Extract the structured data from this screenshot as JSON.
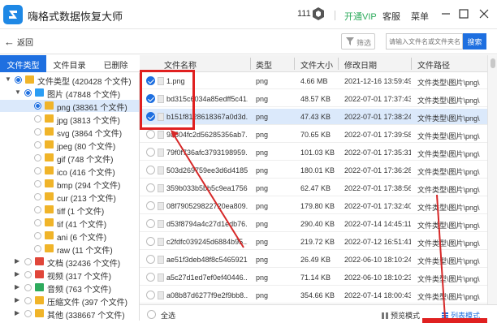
{
  "titlebar": {
    "app_title": "嗨格式数据恢复大师",
    "count": "111",
    "vip": "开通VIP",
    "service": "客服",
    "menu": "菜单"
  },
  "toolbar": {
    "back": "返回",
    "filter": "筛选",
    "search_placeholder": "请输入文件名或文件夹名",
    "search_btn": "搜索"
  },
  "tabs": [
    "文件类型",
    "文件目录",
    "已删除"
  ],
  "tree": [
    {
      "label": "文件类型 (420428 个文件)",
      "indent": 0,
      "exp": "▼",
      "radio": "part",
      "color": "#f0b429"
    },
    {
      "label": "图片 (47848 个文件)",
      "indent": 1,
      "exp": "▼",
      "radio": "part",
      "color": "#2a9df4"
    },
    {
      "label": "png (38361 个文件)",
      "indent": 2,
      "exp": "",
      "radio": "part",
      "color": "#f0b429",
      "selected": true
    },
    {
      "label": "jpg (3813 个文件)",
      "indent": 2,
      "exp": "",
      "radio": "none",
      "color": "#f0b429"
    },
    {
      "label": "svg (3864 个文件)",
      "indent": 2,
      "exp": "",
      "radio": "none",
      "color": "#f0b429"
    },
    {
      "label": "jpeg (80 个文件)",
      "indent": 2,
      "exp": "",
      "radio": "none",
      "color": "#f0b429"
    },
    {
      "label": "gif (748 个文件)",
      "indent": 2,
      "exp": "",
      "radio": "none",
      "color": "#f0b429"
    },
    {
      "label": "ico (416 个文件)",
      "indent": 2,
      "exp": "",
      "radio": "none",
      "color": "#f0b429"
    },
    {
      "label": "bmp (294 个文件)",
      "indent": 2,
      "exp": "",
      "radio": "none",
      "color": "#f0b429"
    },
    {
      "label": "cur (213 个文件)",
      "indent": 2,
      "exp": "",
      "radio": "none",
      "color": "#f0b429"
    },
    {
      "label": "tiff (1 个文件)",
      "indent": 2,
      "exp": "",
      "radio": "none",
      "color": "#f0b429"
    },
    {
      "label": "tif (41 个文件)",
      "indent": 2,
      "exp": "",
      "radio": "none",
      "color": "#f0b429"
    },
    {
      "label": "ani (6 个文件)",
      "indent": 2,
      "exp": "",
      "radio": "none",
      "color": "#f0b429"
    },
    {
      "label": "raw (11 个文件)",
      "indent": 2,
      "exp": "",
      "radio": "none",
      "color": "#f0b429"
    },
    {
      "label": "文档 (32436 个文件)",
      "indent": 1,
      "exp": "▶",
      "radio": "none",
      "color": "#e0463a"
    },
    {
      "label": "视频 (317 个文件)",
      "indent": 1,
      "exp": "▶",
      "radio": "none",
      "color": "#e0463a"
    },
    {
      "label": "音频 (763 个文件)",
      "indent": 1,
      "exp": "▶",
      "radio": "none",
      "color": "#2eab5d"
    },
    {
      "label": "压缩文件 (397 个文件)",
      "indent": 1,
      "exp": "▶",
      "radio": "none",
      "color": "#f0b429"
    },
    {
      "label": "其他 (338667 个文件)",
      "indent": 1,
      "exp": "▶",
      "radio": "none",
      "color": "#f0b429"
    }
  ],
  "columns": [
    "文件名称",
    "类型",
    "文件大小",
    "修改日期",
    "文件路径"
  ],
  "rows": [
    {
      "name": "1.png",
      "type": "png",
      "size": "4.66 MB",
      "date": "2021-12-16 13:59:49",
      "path": "文件类型\\图片\\png\\",
      "checked": true
    },
    {
      "name": "bd315c6034a85edff5c41...",
      "type": "png",
      "size": "48.57 KB",
      "date": "2022-07-01 17:37:43",
      "path": "文件类型\\图片\\png\\",
      "checked": true
    },
    {
      "name": "b151f8128618367a0d3d...",
      "type": "png",
      "size": "47.43 KB",
      "date": "2022-07-01 17:38:24",
      "path": "文件类型\\图片\\png\\",
      "checked": true,
      "selected": true
    },
    {
      "name": "9a504fc2d56285356ab7...",
      "type": "png",
      "size": "70.65 KB",
      "date": "2022-07-01 17:39:58",
      "path": "文件类型\\图片\\png\\",
      "checked": false
    },
    {
      "name": "79f0f736afc3793198959...",
      "type": "png",
      "size": "101.03 KB",
      "date": "2022-07-01 17:35:31",
      "path": "文件类型\\图片\\png\\",
      "checked": false
    },
    {
      "name": "503d269759ee3d6d4185...",
      "type": "png",
      "size": "180.01 KB",
      "date": "2022-07-01 17:36:28",
      "path": "文件类型\\图片\\png\\",
      "checked": false
    },
    {
      "name": "359b033b5bb5c9ea1756...",
      "type": "png",
      "size": "62.47 KB",
      "date": "2022-07-01 17:38:56",
      "path": "文件类型\\图片\\png\\",
      "checked": false
    },
    {
      "name": "08f790529822720ea809...",
      "type": "png",
      "size": "179.80 KB",
      "date": "2022-07-01 17:32:40",
      "path": "文件类型\\图片\\png\\",
      "checked": false
    },
    {
      "name": "d53f8794a4c27d1edb76...",
      "type": "png",
      "size": "290.40 KB",
      "date": "2022-07-14 14:45:11",
      "path": "文件类型\\图片\\png\\",
      "checked": false
    },
    {
      "name": "c2fdfc039245d6884b95...",
      "type": "png",
      "size": "219.72 KB",
      "date": "2022-07-12 16:51:41",
      "path": "文件类型\\图片\\png\\",
      "checked": false
    },
    {
      "name": "ae51f3deb48f8c5465921...",
      "type": "png",
      "size": "26.49 KB",
      "date": "2022-06-10 18:10:24",
      "path": "文件类型\\图片\\png\\",
      "checked": false
    },
    {
      "name": "a5c27d1ed7ef0ef40446...",
      "type": "png",
      "size": "71.14 KB",
      "date": "2022-06-10 18:10:23",
      "path": "文件类型\\图片\\png\\",
      "checked": false
    },
    {
      "name": "a08b87d6277f9e2f9bb8...",
      "type": "png",
      "size": "354.66 KB",
      "date": "2022-07-14 18:00:43",
      "path": "文件类型\\图片\\png\\",
      "checked": false
    }
  ],
  "bottom": {
    "select_all": "全选",
    "preview_mode": "预览模式",
    "list_mode": "列表模式"
  }
}
